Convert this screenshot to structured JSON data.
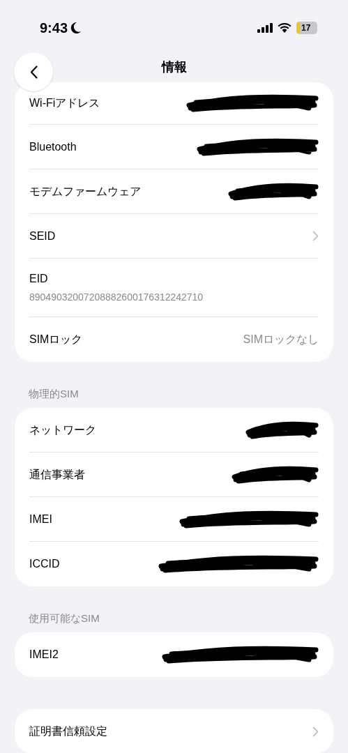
{
  "status_bar": {
    "time": "9:43",
    "battery": "17"
  },
  "nav": {
    "title": "情報"
  },
  "sections": [
    {
      "rows": [
        {
          "label": "Wi-Fiアドレス",
          "kind": "redacted"
        },
        {
          "label": "Bluetooth",
          "kind": "redacted"
        },
        {
          "label": "モデムファームウェア",
          "kind": "redacted"
        },
        {
          "label": "SEID",
          "kind": "chevron"
        },
        {
          "label": "EID",
          "kind": "stacked",
          "value": "89049032007208882600176312242710"
        },
        {
          "label": "SIMロック",
          "kind": "value",
          "value": "SIMロックなし"
        }
      ]
    },
    {
      "header": "物理的SIM",
      "rows": [
        {
          "label": "ネットワーク",
          "kind": "redacted"
        },
        {
          "label": "通信事業者",
          "kind": "redacted"
        },
        {
          "label": "IMEI",
          "kind": "redacted"
        },
        {
          "label": "ICCID",
          "kind": "redacted"
        }
      ]
    },
    {
      "header": "使用可能なSIM",
      "rows": [
        {
          "label": "IMEI2",
          "kind": "redacted"
        }
      ]
    },
    {
      "rows": [
        {
          "label": "証明書信頼設定",
          "kind": "chevron"
        }
      ]
    }
  ]
}
